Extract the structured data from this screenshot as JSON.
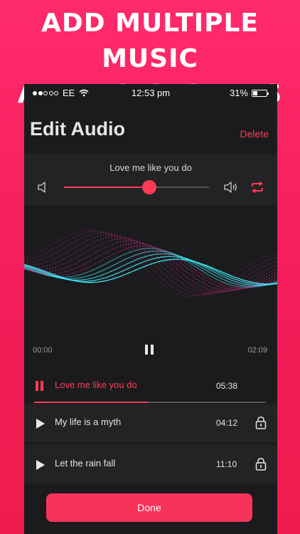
{
  "headline": {
    "line1": "ADD MULTIPLE MUSIC",
    "line2": "AND VOICEOVERS"
  },
  "status_bar": {
    "carrier": "EE",
    "signal_bars_filled": 2,
    "signal_bars_total": 5,
    "time": "12:53 pm",
    "battery": "31%",
    "battery_level": 0.31
  },
  "header": {
    "title": "Edit Audio",
    "delete_label": "Delete"
  },
  "current_audio": {
    "name": "Love me like you do",
    "volume": 0.59
  },
  "player": {
    "elapsed": "00:00",
    "total": "02:09"
  },
  "tracks": [
    {
      "name": "Love me like you do",
      "duration": "05:38",
      "state": "playing",
      "progress": 0.49
    },
    {
      "name": "My life is a myth",
      "duration": "04:12",
      "state": "stopped"
    },
    {
      "name": "Let the rain fall",
      "duration": "11:10",
      "state": "stopped"
    }
  ],
  "done_label": "Done",
  "colors": {
    "accent": "#ff3b57",
    "background": "#1b1b1d",
    "panel": "#232325",
    "wave_cyan": "#3ff0ff",
    "wave_magenta": "#ff2fa8"
  },
  "icons": [
    "speaker-low-icon",
    "speaker-high-icon",
    "repeat-icon",
    "pause-icon",
    "play-icon",
    "lock-icon",
    "wifi-icon",
    "battery-icon"
  ]
}
